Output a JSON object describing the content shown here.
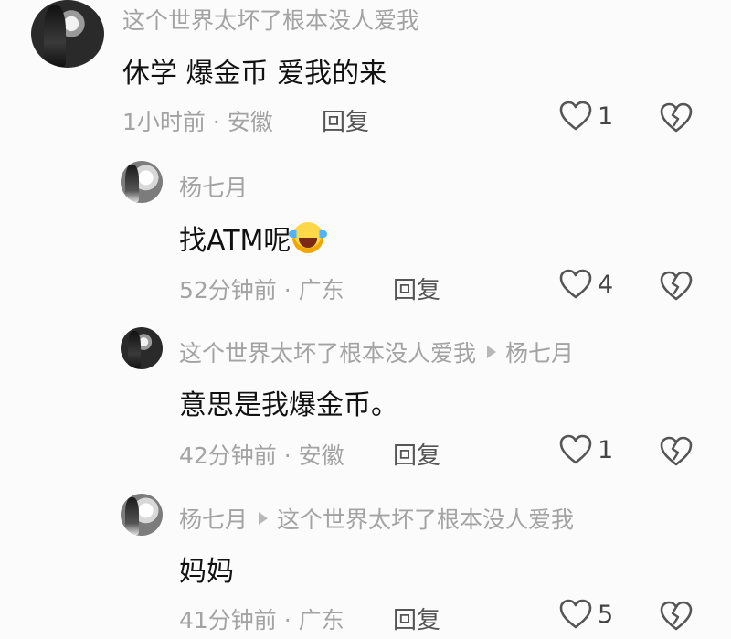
{
  "comments": [
    {
      "user": "这个世界太坏了根本没人爱我",
      "content": "休学 爆金币 爱我的来",
      "time_location": "1小时前 · 安徽",
      "reply_label": "回复",
      "likes": "1"
    },
    {
      "user": "杨七月",
      "content": "找ATM呢",
      "emoji": "laughing-crying-emoji",
      "time_location": "52分钟前 · 广东",
      "reply_label": "回复",
      "likes": "4"
    },
    {
      "user": "这个世界太坏了根本没人爱我",
      "reply_to": "杨七月",
      "content": "意思是我爆金币。",
      "time_location": "42分钟前 · 安徽",
      "reply_label": "回复",
      "likes": "1"
    },
    {
      "user": "杨七月",
      "reply_to": "这个世界太坏了根本没人爱我",
      "content": "妈妈",
      "time_location": "41分钟前 · 广东",
      "reply_label": "回复",
      "likes": "5"
    }
  ],
  "icons": {
    "like": "heart-outline-icon",
    "dislike": "broken-heart-icon",
    "reply_arrow": "triangle-right-icon"
  },
  "colors": {
    "meta_text": "#a3a3a3",
    "body_text": "#111111",
    "icon_stroke": "#555555"
  }
}
